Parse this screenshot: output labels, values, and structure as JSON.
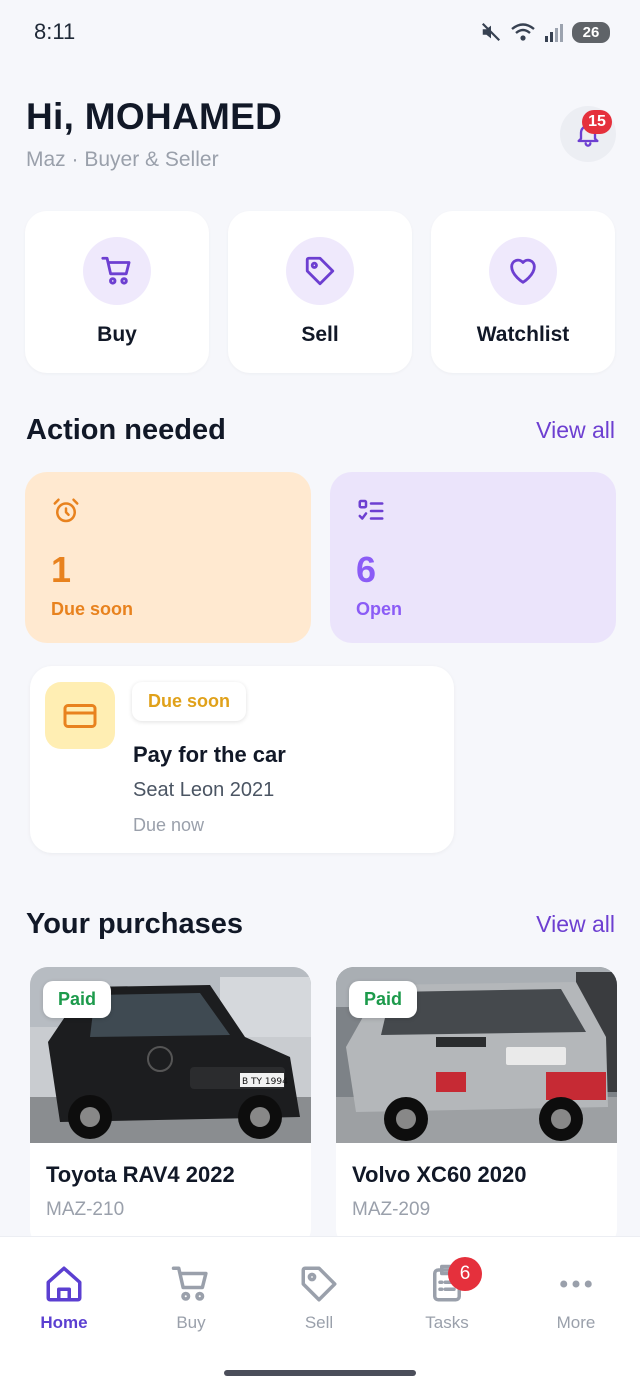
{
  "status_bar": {
    "time": "8:11",
    "battery": "26"
  },
  "header": {
    "greeting": "Hi, MOHAMED",
    "subtitle": "Maz · Buyer & Seller",
    "notification_count": "15"
  },
  "quick_actions": [
    {
      "label": "Buy",
      "icon": "cart-icon"
    },
    {
      "label": "Sell",
      "icon": "tag-icon"
    },
    {
      "label": "Watchlist",
      "icon": "heart-icon"
    }
  ],
  "action_needed": {
    "title": "Action needed",
    "view_all": "View all",
    "stats": [
      {
        "value": "1",
        "label": "Due soon",
        "icon": "alarm-clock-icon",
        "color": "#e8821e"
      },
      {
        "value": "6",
        "label": "Open",
        "icon": "checklist-icon",
        "color": "#8b5cf6"
      }
    ],
    "task": {
      "chip": "Due soon",
      "title": "Pay for the car",
      "subtitle": "Seat Leon 2021",
      "due": "Due now",
      "icon": "credit-card-icon"
    }
  },
  "purchases": {
    "title": "Your purchases",
    "view_all": "View all",
    "items": [
      {
        "status": "Paid",
        "name": "Toyota RAV4 2022",
        "ref": "MAZ-210",
        "plate": "B TY 1994"
      },
      {
        "status": "Paid",
        "name": "Volvo XC60 2020",
        "ref": "MAZ-209"
      }
    ]
  },
  "bottom_nav": {
    "items": [
      {
        "label": "Home",
        "icon": "home-icon",
        "active": true
      },
      {
        "label": "Buy",
        "icon": "cart-icon"
      },
      {
        "label": "Sell",
        "icon": "tag-icon"
      },
      {
        "label": "Tasks",
        "icon": "clipboard-icon",
        "badge": "6"
      },
      {
        "label": "More",
        "icon": "more-dots-icon"
      }
    ]
  },
  "colors": {
    "accent": "#6d3fd1",
    "paid": "#1c9a4b",
    "badge": "#e5303c"
  }
}
